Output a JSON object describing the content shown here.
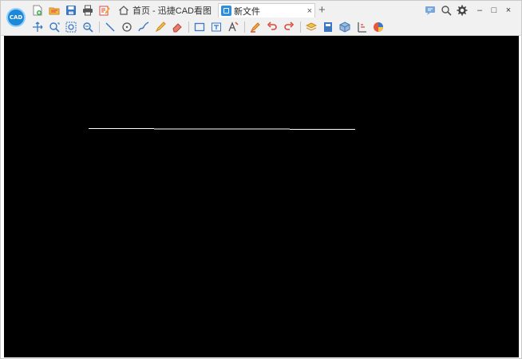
{
  "app": {
    "logo_text": "CAD"
  },
  "tabs": {
    "home_label": "首页 - 迅捷CAD看图",
    "active_label": "新文件",
    "close_glyph": "×",
    "new_tab_glyph": "+"
  },
  "toolbar_row1": [
    "new-file-icon",
    "open-folder-icon",
    "save-icon",
    "print-icon",
    "edit-doc-icon"
  ],
  "toolbar_row2": [
    "pan-icon",
    "zoom-window-icon",
    "zoom-extents-icon",
    "zoom-realtime-icon",
    "line-icon",
    "circle-icon",
    "polyline-icon",
    "pencil-icon",
    "eraser-icon",
    "rectangle-select-icon",
    "text-box-icon",
    "text-style-icon",
    "highlighter-icon",
    "undo-icon",
    "redo-icon",
    "layers-icon",
    "book-icon",
    "3d-box-icon",
    "measure-icon",
    "color-wheel-icon"
  ],
  "window": {
    "controls": [
      "feedback-icon",
      "search-icon",
      "settings-icon"
    ],
    "minimize_glyph": "–",
    "maximize_glyph": "□",
    "close_glyph": "×"
  },
  "canvas": {
    "background": "#000000",
    "line_color": "#ffffff"
  },
  "colors": {
    "accent": "#2a8fe0",
    "toolbar_bg": "#f1f1f1"
  }
}
